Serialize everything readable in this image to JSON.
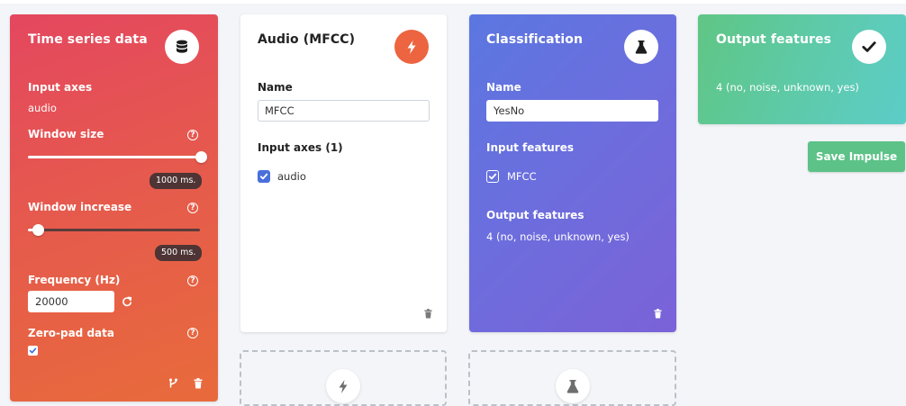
{
  "time_series": {
    "title": "Time series data",
    "input_axes_label": "Input axes",
    "input_axes_value": "audio",
    "window_size_label": "Window size",
    "window_size_value": "1000 ms.",
    "window_size_fraction": 1.0,
    "window_increase_label": "Window increase",
    "window_increase_value": "500 ms.",
    "window_increase_fraction": 0.05,
    "frequency_label": "Frequency (Hz)",
    "frequency_value": "20000",
    "zero_pad_label": "Zero-pad data",
    "zero_pad_checked": true,
    "help_glyph": "?",
    "icon": "database-icon"
  },
  "processing": {
    "title": "Audio (MFCC)",
    "name_label": "Name",
    "name_value": "MFCC",
    "input_axes_label": "Input axes (1)",
    "axis_item": "audio",
    "icon": "lightning-icon"
  },
  "learning": {
    "title": "Classification",
    "name_label": "Name",
    "name_value": "YesNo",
    "input_features_label": "Input features",
    "input_feature_item": "MFCC",
    "output_features_label": "Output features",
    "output_features_value": "4 (no, noise, unknown, yes)",
    "icon": "flask-icon"
  },
  "output": {
    "title": "Output features",
    "value": "4 (no, noise, unknown, yes)",
    "icon": "check-icon"
  },
  "save_button": "Save Impulse",
  "colors": {
    "time_series_gradient": [
      "#e24a5f",
      "#e76a3a"
    ],
    "processing_accent": "#ec6440",
    "learning_gradient": [
      "#5a79e0",
      "#7a62d8"
    ],
    "output_gradient": [
      "#5ec787",
      "#5ccdc5"
    ],
    "save_button": "#5cc287",
    "checkbox_blue": "#4a6fdc"
  }
}
